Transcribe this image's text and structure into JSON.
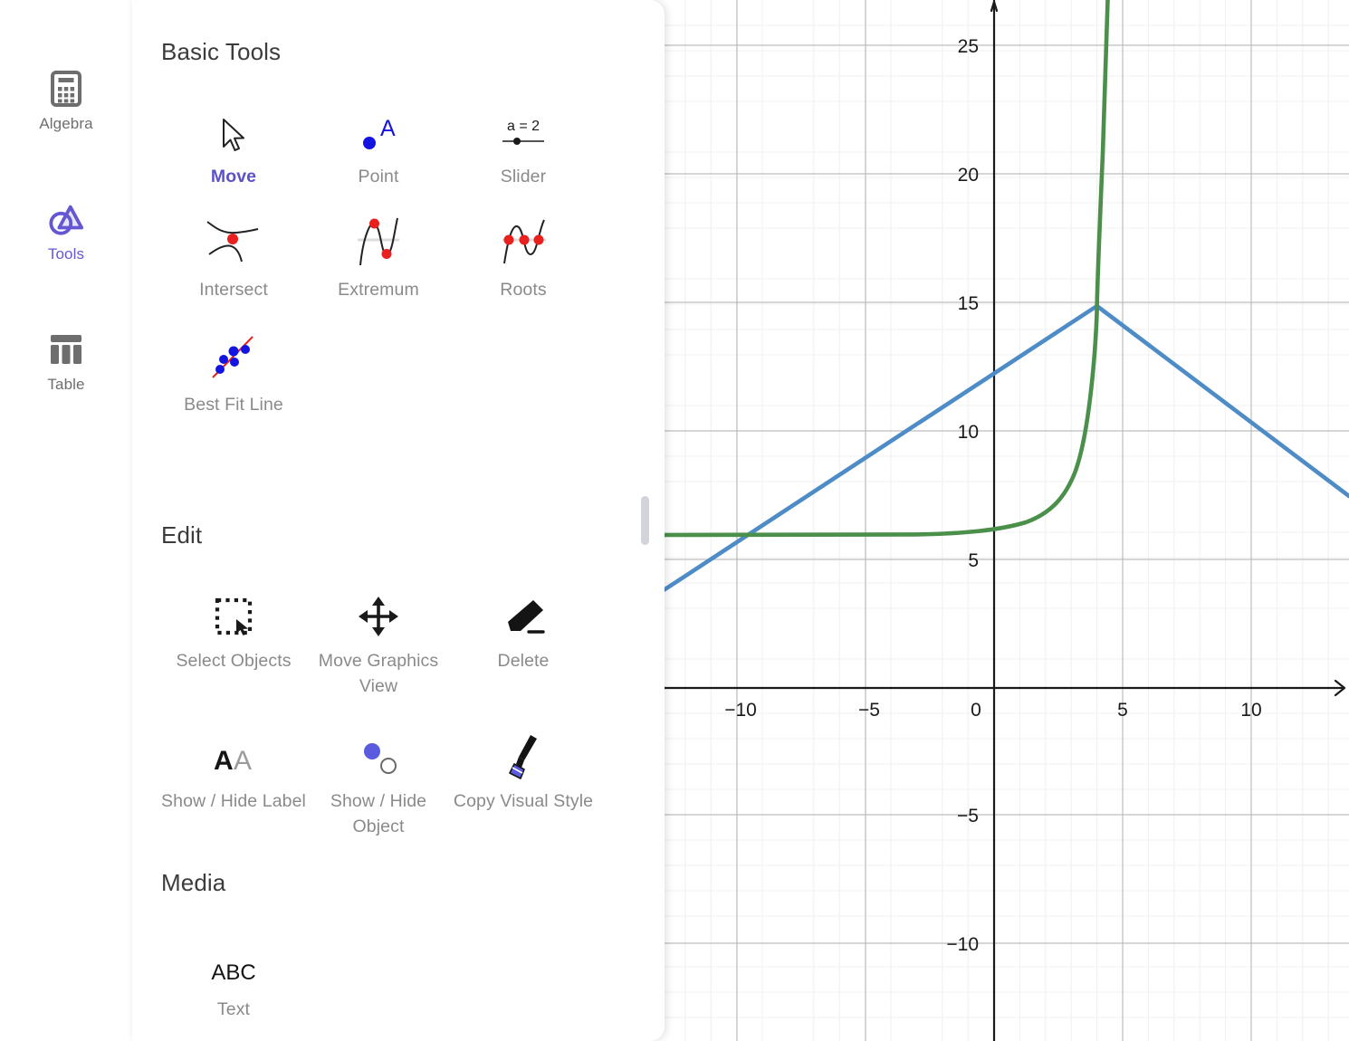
{
  "app": {
    "accent_purple": "#6557d2",
    "label_gray": "#8a8a8a",
    "curve_blue": "#4e8cc8",
    "curve_green": "#4a8f4a"
  },
  "rail": {
    "items": [
      {
        "label": "Algebra",
        "icon": "calculator-icon",
        "active": false
      },
      {
        "label": "Tools",
        "icon": "geogebra-tools-icon",
        "active": true
      },
      {
        "label": "Table",
        "icon": "table-icon",
        "active": false
      }
    ]
  },
  "panel": {
    "sections": [
      {
        "title": "Basic Tools",
        "tools": [
          {
            "label": "Move",
            "icon": "arrow-cursor-icon",
            "active": true
          },
          {
            "label": "Point",
            "icon": "point-a-icon",
            "active": false
          },
          {
            "label": "Slider",
            "icon": "slider-icon",
            "active": false
          },
          {
            "label": "Intersect",
            "icon": "intersect-icon",
            "active": false
          },
          {
            "label": "Extremum",
            "icon": "extremum-icon",
            "active": false
          },
          {
            "label": "Roots",
            "icon": "roots-icon",
            "active": false
          },
          {
            "label": "Best Fit Line",
            "icon": "best-fit-line-icon",
            "active": false
          }
        ]
      },
      {
        "title": "Edit",
        "tools": [
          {
            "label": "Select Objects",
            "icon": "select-objects-icon",
            "active": false
          },
          {
            "label": "Move Graphics View",
            "icon": "move-graphics-view-icon",
            "active": false
          },
          {
            "label": "Delete",
            "icon": "eraser-icon",
            "active": false
          },
          {
            "label": "Show / Hide Label",
            "icon": "show-hide-label-icon",
            "active": false
          },
          {
            "label": "Show / Hide Object",
            "icon": "show-hide-object-icon",
            "active": false
          },
          {
            "label": "Copy Visual Style",
            "icon": "paintbrush-icon",
            "active": false
          }
        ]
      },
      {
        "title": "Media",
        "tools": [
          {
            "label": "Text",
            "icon": "abc-text-icon",
            "active": false
          }
        ]
      }
    ],
    "slider_icon_label": "a = 2",
    "text_icon_label": "ABC",
    "point_icon_label": "A",
    "show_hide_label_glyphs": "AA"
  },
  "chart_data": {
    "type": "line",
    "title": "",
    "xlabel": "",
    "ylabel": "",
    "xlim": [
      -13.5,
      13.8
    ],
    "ylim": [
      -13.9,
      27.0
    ],
    "grid": true,
    "minor_grid_step": 1,
    "major_grid_step": 5,
    "legend": "none",
    "x_ticks": [
      -10,
      -5,
      0,
      5,
      10
    ],
    "y_ticks": [
      25,
      20,
      15,
      10,
      5,
      -5,
      -10
    ],
    "x_tick_labels": [
      "−10",
      "−5",
      "0",
      "5",
      "10"
    ],
    "y_tick_labels": [
      "25",
      "20",
      "15",
      "10",
      "5",
      "−5",
      "−10"
    ],
    "series": [
      {
        "name": "blue-v-curve",
        "color": "#4e8cc8",
        "width": 4,
        "comment": "V-shaped absolute value, vertex (4,15), left slope 1, right slope -0.75",
        "points": [
          [
            -13.5,
            3.5
          ],
          [
            -10,
            7.0
          ],
          [
            -5,
            12.0
          ],
          [
            -4.2,
            12.8
          ],
          [
            0,
            12.3
          ],
          [
            0,
            12.3
          ],
          [
            4,
            15.0
          ],
          [
            8,
            12.0
          ],
          [
            13.8,
            8.0
          ]
        ],
        "vertex": [
          4,
          15
        ]
      },
      {
        "name": "green-exponential-curve",
        "color": "#4a8f4a",
        "width": 4,
        "comment": "Exponential with horizontal asymptote y=6, passes (4,15), steep rise",
        "asymptote_y": 6,
        "points": [
          [
            -13.5,
            6.0
          ],
          [
            -10,
            6.0
          ],
          [
            -5,
            6.05
          ],
          [
            -2,
            6.1
          ],
          [
            0,
            6.2
          ],
          [
            1,
            6.4
          ],
          [
            2,
            7.0
          ],
          [
            2.6,
            8.0
          ],
          [
            3.0,
            9.5
          ],
          [
            3.3,
            11.0
          ],
          [
            3.6,
            13.0
          ],
          [
            4.0,
            15.0
          ],
          [
            4.1,
            20.0
          ],
          [
            4.2,
            27.0
          ]
        ]
      }
    ]
  }
}
